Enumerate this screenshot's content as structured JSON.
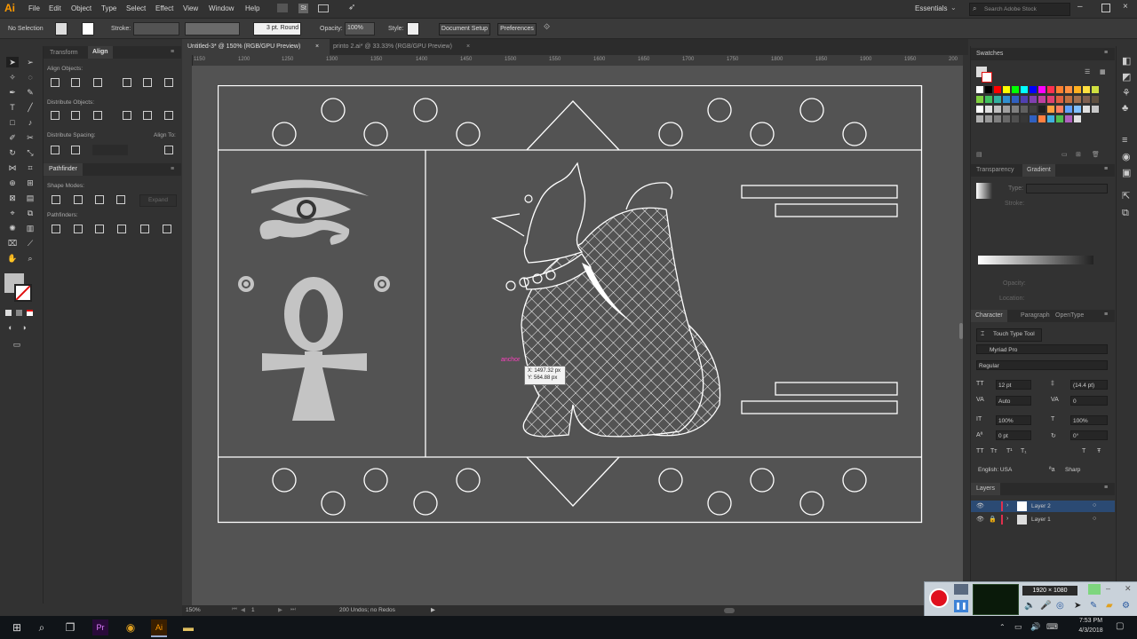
{
  "app": {
    "logo": "Ai",
    "menus": [
      "File",
      "Edit",
      "Object",
      "Type",
      "Select",
      "Effect",
      "View",
      "Window",
      "Help"
    ],
    "workspace": "Essentials",
    "search_placeholder": "Search Adobe Stock"
  },
  "control_bar": {
    "selection": "No Selection",
    "stroke_label": "Stroke:",
    "stroke_profile": "3 pt. Round",
    "opacity_label": "Opacity:",
    "opacity_value": "100%",
    "style_label": "Style:",
    "doc_setup": "Document Setup",
    "preferences": "Preferences"
  },
  "tabs": [
    {
      "label": "Untitled-3* @ 150% (RGB/GPU Preview)",
      "close": "×",
      "active": true
    },
    {
      "label": "printo 2.ai* @ 33.33% (RGB/GPU Preview)",
      "close": "×",
      "active": false
    }
  ],
  "ruler_top": [
    "1150",
    "1200",
    "1250",
    "1300",
    "1350",
    "1400",
    "1450",
    "1500",
    "1550",
    "1600",
    "1650",
    "1700",
    "1750",
    "1800",
    "1850",
    "1900",
    "1950",
    "200"
  ],
  "left_panels": {
    "tabs": [
      "Transform",
      "Align"
    ],
    "align_objects": "Align Objects:",
    "distribute_objects": "Distribute Objects:",
    "distribute_spacing": "Distribute Spacing:",
    "align_to": "Align To:",
    "pathfinder_tab": "Pathfinder",
    "shape_modes": "Shape Modes:",
    "expand": "Expand",
    "pathfinders": "Pathfinders:"
  },
  "canvas": {
    "anchor_label": "anchor",
    "x_readout": "X: 1497.32 px",
    "y_readout": "Y: 564.88 px"
  },
  "right_panel": {
    "swatches_title": "Swatches",
    "transparency_tab": "Transparency",
    "gradient_tab": "Gradient",
    "type_label": "Type:",
    "stroke_label": "Stroke:",
    "opacity_label": "Opacity:",
    "location_label": "Location:",
    "character_tab": "Character",
    "paragraph_tab": "Paragraph",
    "opentype_tab": "OpenType",
    "touch_type": "Touch Type Tool",
    "font_family": "Myriad Pro",
    "font_style": "Regular",
    "font_size": "12 pt",
    "leading": "(14.4 pt)",
    "kerning": "Auto",
    "tracking": "0",
    "vscale": "100%",
    "hscale": "100%",
    "baseline": "0 pt",
    "rotation": "0°",
    "language": "English: USA",
    "aa": "Sharp",
    "layers_title": "Layers",
    "layers": [
      "Layer 2",
      "Layer 1"
    ]
  },
  "status_bar": {
    "zoom": "150%",
    "page": "1",
    "info": "200 Undos; no Redos"
  },
  "recorder": {
    "resolution": "1920 × 1080"
  },
  "taskbar": {
    "time": "7:53 PM",
    "date": "4/3/2018"
  },
  "colors": {
    "accent": "#ff9a00",
    "record": "#e0101e",
    "layer_selected": "#2b4a73"
  }
}
